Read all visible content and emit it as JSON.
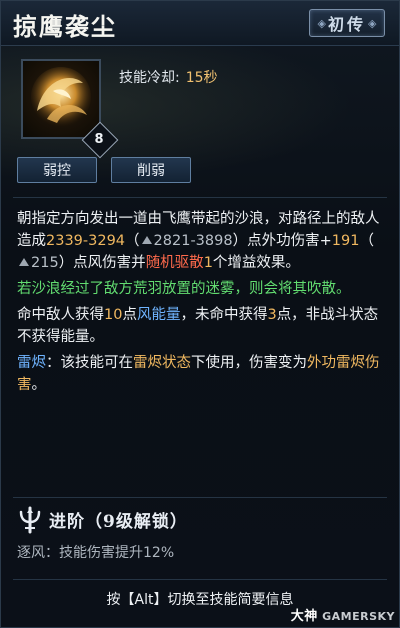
{
  "skill": {
    "name": "掠鹰袭尘",
    "grade": "初传",
    "level": "8",
    "cooldown_label": "技能冷却:",
    "cooldown_value": "15秒",
    "tags": [
      "弱控",
      "削弱"
    ]
  },
  "description": {
    "p1": {
      "t1": "朝指定方向发出一道由飞鹰带起的沙浪，对路径上的敌人造成",
      "dmg": "2339-3294",
      "t2": "（",
      "dmg_up": "2821-3898",
      "t3": "）点外功伤害+",
      "bonus": "191",
      "t4": "（",
      "bonus_up": "215",
      "t5": "）点风伤害并",
      "dispel": "随机驱散",
      "dispel_count": "1",
      "t6": "个增益效果。"
    },
    "p2": "若沙浪经过了敌方荒羽放置的迷雾，则会将其吹散。",
    "p3": {
      "t1": "命中敌人获得",
      "hit_energy": "10",
      "t2": "点",
      "energy": "风能量",
      "t3": "，未命中获得",
      "miss_energy": "3",
      "t4": "点，非战斗状态不获得能量。"
    },
    "p4": {
      "label": "雷烬",
      "t1": "：该技能可在",
      "state": "雷烬状态",
      "t2": "下使用，伤害变为",
      "result": "外功雷烬伤害",
      "t3": "。"
    }
  },
  "advance": {
    "title": "进阶（9级解锁）",
    "line": "逐风：技能伤害提升12%"
  },
  "footer": "按【Alt】切换至技能简要信息",
  "watermark": {
    "a": "大神",
    "b": "GAMERSKY"
  }
}
